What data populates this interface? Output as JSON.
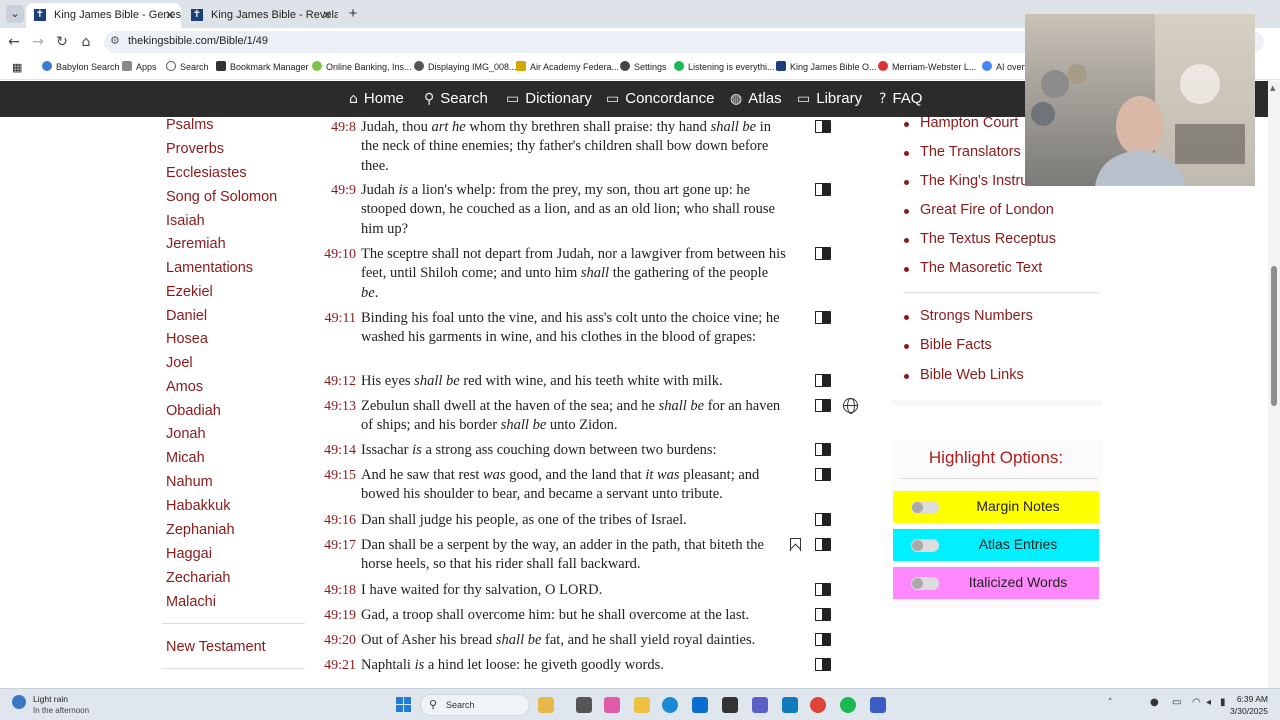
{
  "browser": {
    "tabs": [
      {
        "title": "King James Bible - Genesis <sp"
      },
      {
        "title": "King James Bible - Revelation"
      }
    ],
    "url": "thekingsbible.com/Bible/1/49",
    "bookmarks": [
      "Babylon Search",
      "Apps",
      "Search",
      "Bookmark Manager",
      "Online Banking, Ins...",
      "Displaying IMG_008...",
      "Air Academy Federa...",
      "Settings",
      "Listening is everythi...",
      "King James Bible O...",
      "Merriam-Webster L...",
      "AI overv"
    ]
  },
  "site_nav": [
    {
      "label": "Home",
      "icon": "home-icon"
    },
    {
      "label": "Search",
      "icon": "search-icon"
    },
    {
      "label": "Dictionary",
      "icon": "book-open-icon"
    },
    {
      "label": "Concordance",
      "icon": "book-icon"
    },
    {
      "label": "Atlas",
      "icon": "globe-icon"
    },
    {
      "label": "Library",
      "icon": "library-icon"
    },
    {
      "label": "FAQ",
      "icon": "question-icon"
    }
  ],
  "books": [
    "Psalms",
    "Proverbs",
    "Ecclesiastes",
    "Song of Solomon",
    "Isaiah",
    "Jeremiah",
    "Lamentations",
    "Ezekiel",
    "Daniel",
    "Hosea",
    "Joel",
    "Amos",
    "Obadiah",
    "Jonah",
    "Micah",
    "Nahum",
    "Habakkuk",
    "Zephaniah",
    "Haggai",
    "Zechariah",
    "Malachi"
  ],
  "new_testament": "New Testament",
  "verses": [
    {
      "ref": "49:8",
      "html": "Judah, thou <i>art he</i> whom thy brethren shall praise: thy hand <i>shall be</i> in the neck of thine enemies; thy father's children shall bow down before thee."
    },
    {
      "ref": "49:9",
      "html": "Judah <i>is</i> a lion's whelp: from the prey, my son, thou art gone up: he stooped down, he couched as a lion, and as an old lion; who shall rouse him up?"
    },
    {
      "ref": "49:10",
      "html": "The sceptre shall not depart from Judah, nor a lawgiver from between his feet, until Shiloh come; and unto him <i>shall</i> the gathering of the people <i>be</i>."
    },
    {
      "ref": "49:11",
      "html": "Binding his foal unto the vine, and his ass's colt unto the choice vine; he washed his garments in wine, and his clothes in the blood of grapes:"
    },
    {
      "ref": "49:12",
      "html": "His eyes <i>shall be</i> red with wine, and his teeth white with milk."
    },
    {
      "ref": "49:13",
      "html": "Zebulun shall dwell at the haven of the sea; and he <i>shall be</i> for an haven of ships; and his border <i>shall be</i> unto Zidon."
    },
    {
      "ref": "49:14",
      "html": "Issachar <i>is</i> a strong ass couching down between two burdens:"
    },
    {
      "ref": "49:15",
      "html": "And he saw that rest <i>was</i> good, and the land that <i>it was</i> pleasant; and bowed his shoulder to bear, and became a servant unto tribute."
    },
    {
      "ref": "49:16",
      "html": "Dan shall judge his people, as one of the tribes of Israel."
    },
    {
      "ref": "49:17",
      "html": "Dan shall be a serpent by the way, an adder in the path, that biteth the horse heels, so that his rider shall fall backward."
    },
    {
      "ref": "49:18",
      "html": "I have waited for thy salvation, O LORD."
    },
    {
      "ref": "49:19",
      "html": "Gad, a troop shall overcome him: but he shall overcome at the last."
    },
    {
      "ref": "49:20",
      "html": "Out of Asher his bread <i>shall be</i> fat, and he shall yield royal dainties."
    },
    {
      "ref": "49:21",
      "html": "Naphtali <i>is</i> a hind let loose: he giveth goodly words."
    }
  ],
  "right_links_1": [
    "Hampton Court",
    "The Translators",
    "The King's Instru",
    "Great Fire of London",
    "The Textus Receptus",
    "The Masoretic Text"
  ],
  "right_links_2": [
    "Strongs Numbers",
    "Bible Facts",
    "Bible Web Links"
  ],
  "highlight": {
    "title": "Highlight Options:",
    "options": [
      {
        "label": "Margin Notes",
        "color": "#ffff00"
      },
      {
        "label": "Atlas Entries",
        "color": "#00f0ff"
      },
      {
        "label": "Italicized Words",
        "color": "#ff88ff"
      }
    ]
  },
  "taskbar": {
    "weather_title": "Light rain",
    "weather_sub": "In the afternoon",
    "search": "Search",
    "time": "6:39 AM",
    "date": "3/30/2025"
  }
}
